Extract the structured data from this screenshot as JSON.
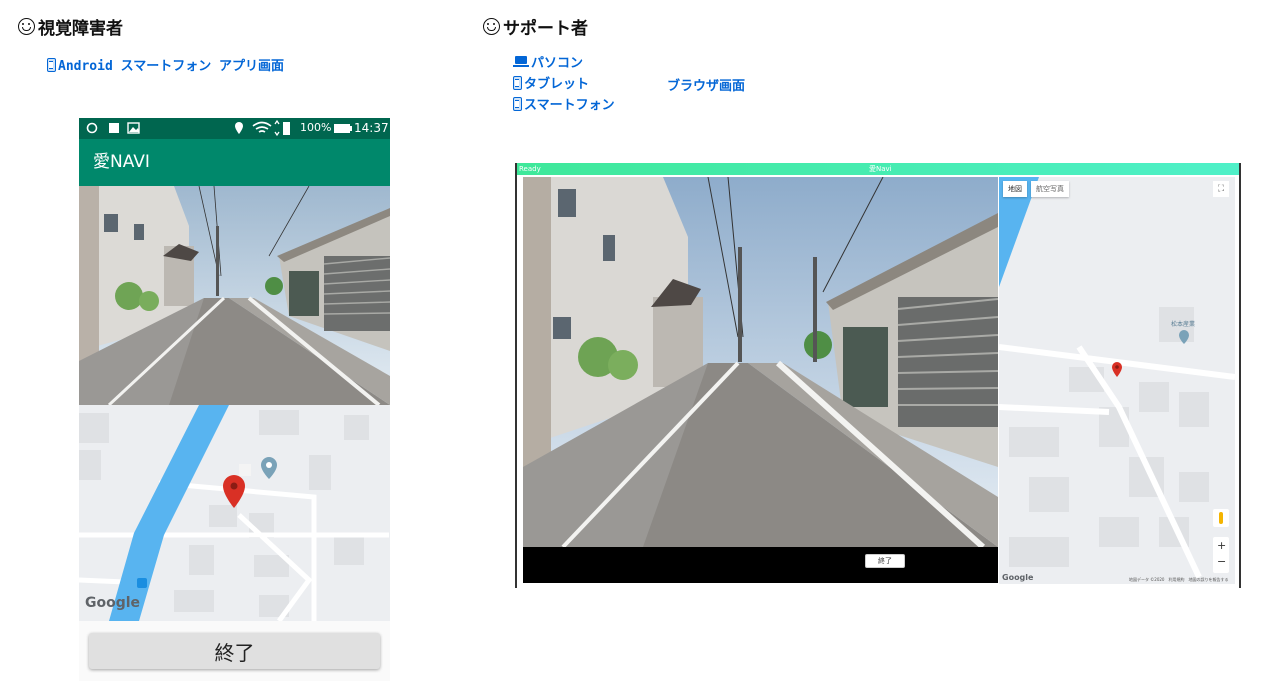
{
  "left_section": {
    "heading": "視覚障害者",
    "link": "Android スマートフォン アプリ画面"
  },
  "right_section": {
    "heading": "サポート者",
    "device_links": [
      "パソコン",
      "タブレット",
      "スマートフォン"
    ],
    "browser_link": "ブラウザ画面"
  },
  "phone": {
    "status": {
      "battery": "100%",
      "time": "14:37"
    },
    "app_title": "愛NAVI",
    "end_button": "終了",
    "google_logo": "Google"
  },
  "browser": {
    "status_left": "Ready",
    "window_title": "愛Navi",
    "end_button": "終了",
    "map_tabs": [
      "地図",
      "航空写真"
    ],
    "place_label": "松本産業",
    "google_logo": "Google",
    "map_footer": "地図データ ©2020　利用規約　地図の誤りを報告する",
    "zoom_in": "+",
    "zoom_out": "−"
  },
  "colors": {
    "status_bar": "#00664f",
    "app_bar": "#00886b",
    "link": "#0366d6",
    "ready_bar": "#3ee89a",
    "pin": "#d93025",
    "river": "#58b4f0"
  }
}
